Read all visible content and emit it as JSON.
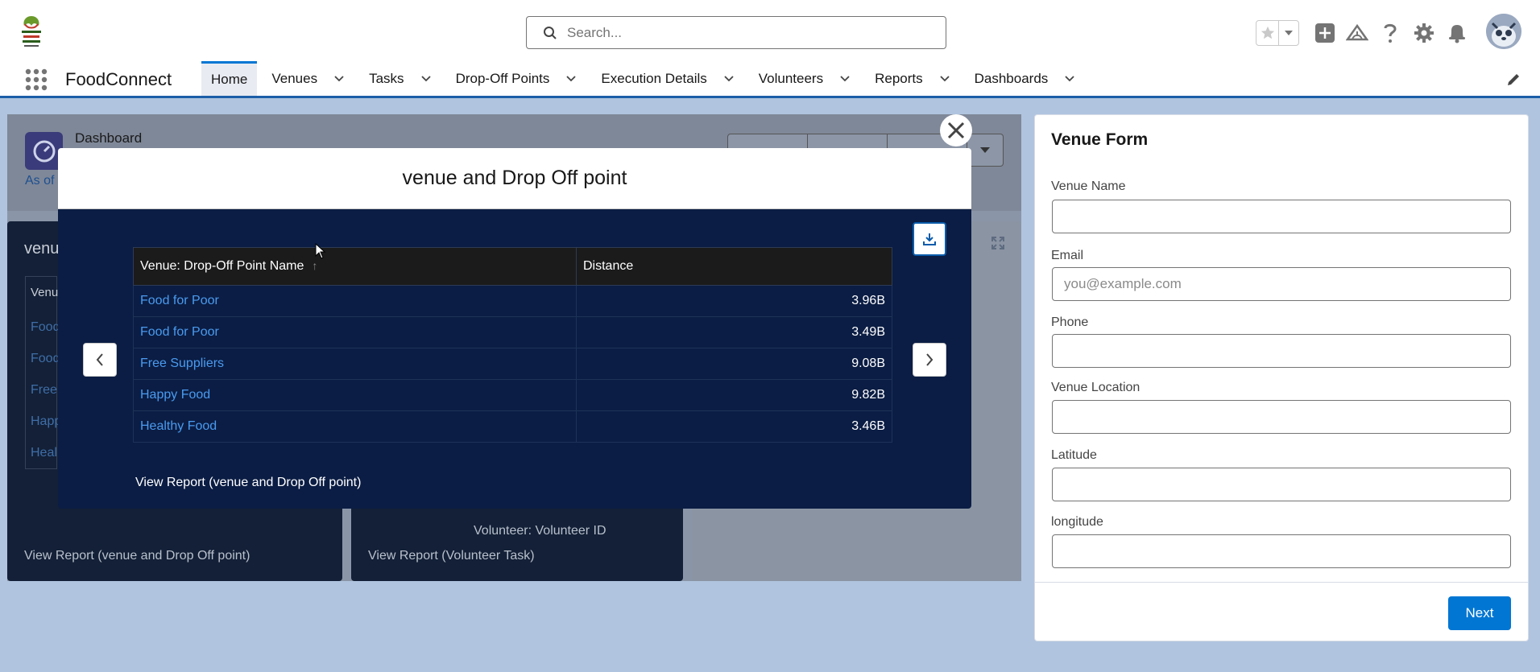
{
  "header": {
    "search_placeholder": "Search...",
    "icons": [
      "favorites-star-icon",
      "add-icon",
      "trailhead-icon",
      "help-icon",
      "setup-gear-icon",
      "notifications-bell-icon",
      "avatar"
    ]
  },
  "nav": {
    "app_name": "FoodConnect",
    "tabs": [
      {
        "label": "Home",
        "active": true,
        "dropdown": false
      },
      {
        "label": "Venues",
        "dropdown": true
      },
      {
        "label": "Tasks",
        "dropdown": true
      },
      {
        "label": "Drop-Off Points",
        "dropdown": true
      },
      {
        "label": "Execution Details",
        "dropdown": true
      },
      {
        "label": "Volunteers",
        "dropdown": true
      },
      {
        "label": "Reports",
        "dropdown": true
      },
      {
        "label": "Dashboards",
        "dropdown": true
      }
    ]
  },
  "dashboard": {
    "label": "Dashboard",
    "as_of": "As of",
    "card1_title": "venu",
    "card1_header": "Venu",
    "card1_rows": [
      "Food",
      "Food",
      "Free",
      "Happ",
      "Heal"
    ],
    "card1_footer": "View Report (venue and Drop Off point)",
    "card2_field": "Volunteer: Volunteer ID",
    "card2_footer": "View Report (Volunteer Task)"
  },
  "modal": {
    "title": "venue and Drop Off point",
    "columns": [
      "Venue: Drop-Off Point Name",
      "Distance"
    ],
    "sort_indicator": "↑",
    "rows": [
      {
        "name": "Food for Poor",
        "distance": "3.96B"
      },
      {
        "name": "Food for Poor",
        "distance": "3.49B"
      },
      {
        "name": "Free Suppliers",
        "distance": "9.08B"
      },
      {
        "name": "Happy Food",
        "distance": "9.82B"
      },
      {
        "name": "Healthy Food",
        "distance": "3.46B"
      }
    ],
    "view_report": "View Report (venue and Drop Off point)"
  },
  "form": {
    "title": "Venue Form",
    "fields": [
      {
        "label": "Venue Name",
        "value": "",
        "placeholder": ""
      },
      {
        "label": "Email",
        "value": "",
        "placeholder": "you@example.com"
      },
      {
        "label": "Phone",
        "value": "",
        "placeholder": ""
      },
      {
        "label": "Venue Location",
        "value": "",
        "placeholder": ""
      },
      {
        "label": "Latitude",
        "value": "",
        "placeholder": ""
      },
      {
        "label": "longitude",
        "value": "",
        "placeholder": ""
      }
    ],
    "next_label": "Next"
  },
  "colors": {
    "brand_blue": "#0176d3",
    "modal_bg": "#0b1d44",
    "link": "#4a9bf0"
  }
}
